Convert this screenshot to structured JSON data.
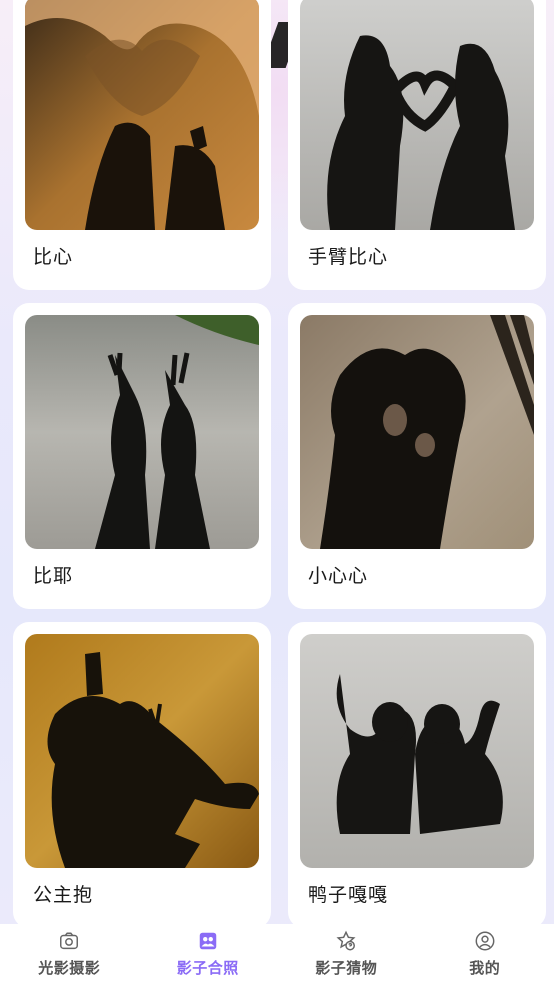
{
  "cards": [
    {
      "label": "比心"
    },
    {
      "label": "手臂比心"
    },
    {
      "label": "比耶"
    },
    {
      "label": "小心心"
    },
    {
      "label": "公主抱"
    },
    {
      "label": "鸭子嘎嘎"
    }
  ],
  "tabs": [
    {
      "label": "光影摄影",
      "icon": "camera-icon",
      "active": false
    },
    {
      "label": "影子合照",
      "icon": "group-photo-icon",
      "active": true
    },
    {
      "label": "影子猜物",
      "icon": "star-question-icon",
      "active": false
    },
    {
      "label": "我的",
      "icon": "profile-icon",
      "active": false
    }
  ],
  "colors": {
    "accent": "#8b6cf6",
    "inactive": "#555555",
    "card": "#ffffff"
  }
}
